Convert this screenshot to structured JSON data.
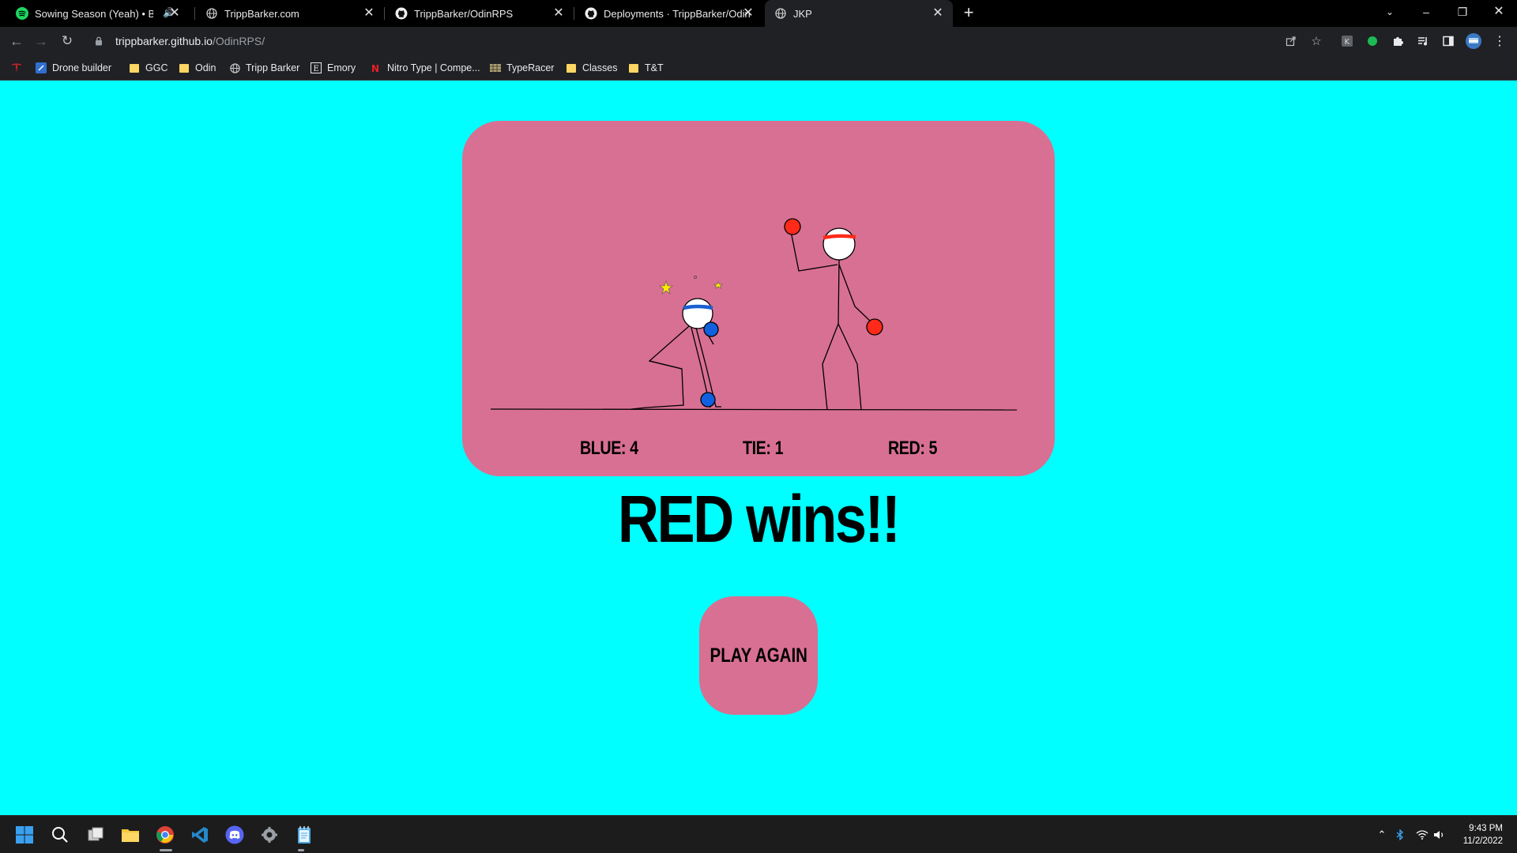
{
  "browser": {
    "tabs": [
      {
        "title": "Sowing Season (Yeah) • Bran",
        "icon": "spotify-icon",
        "audio": true
      },
      {
        "title": "TrippBarker.com",
        "icon": "globe-icon"
      },
      {
        "title": "TrippBarker/OdinRPS",
        "icon": "github-icon"
      },
      {
        "title": "Deployments · TrippBarker/OdinR",
        "icon": "github-icon"
      },
      {
        "title": "JKP",
        "icon": "globe-icon",
        "active": true
      }
    ],
    "url_host": "trippbarker.github.io",
    "url_path": "/OdinRPS/",
    "bookmarks": [
      {
        "label": "Drone builder",
        "icon": "drone-builder-icon"
      },
      {
        "label": "GGC",
        "icon": "folder-icon"
      },
      {
        "label": "Odin",
        "icon": "folder-icon"
      },
      {
        "label": "Tripp Barker",
        "icon": "globe-icon"
      },
      {
        "label": "Emory",
        "icon": "emory-icon"
      },
      {
        "label": "Nitro Type | Compe...",
        "icon": "nitro-type-icon"
      },
      {
        "label": "TypeRacer",
        "icon": "typeracer-icon"
      },
      {
        "label": "Classes",
        "icon": "folder-icon"
      },
      {
        "label": "T&T",
        "icon": "folder-icon"
      }
    ]
  },
  "game": {
    "scores": {
      "blue": "BLUE: 4",
      "tie": "TIE: 1",
      "red": "RED: 5"
    },
    "result": "RED wins!!",
    "play_again_label": "PLAY AGAIN"
  },
  "taskbar": {
    "time": "9:43 PM",
    "date": "11/2/2022"
  },
  "colors": {
    "page_background": "#00ffff",
    "card": "#d87093",
    "red_fighter": "#ff2a1a",
    "blue_fighter": "#1060e0"
  }
}
